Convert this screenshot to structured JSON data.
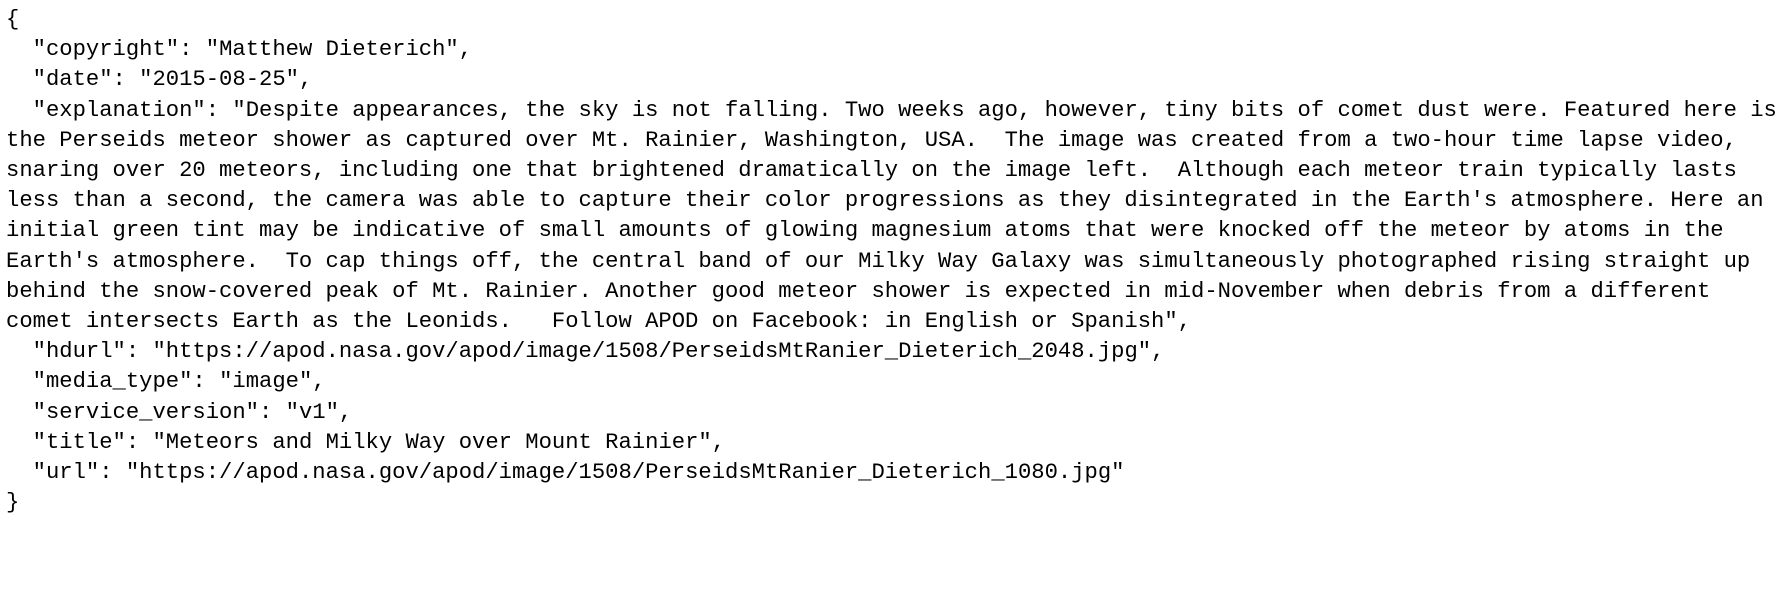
{
  "json_viewer": {
    "open_brace": "{",
    "close_brace": "}",
    "entries": [
      {
        "key": "\"copyright\"",
        "value": "\"Matthew Dieterich\"",
        "trail": ","
      },
      {
        "key": "\"date\"",
        "value": "\"2015-08-25\"",
        "trail": ","
      },
      {
        "key": "\"explanation\"",
        "value": "\"Despite appearances, the sky is not falling. Two weeks ago, however, tiny bits of comet dust were. Featured here is the Perseids meteor shower as captured over Mt. Rainier, Washington, USA.  The image was created from a two-hour time lapse video, snaring over 20 meteors, including one that brightened dramatically on the image left.  Although each meteor train typically lasts less than a second, the camera was able to capture their color progressions as they disintegrated in the Earth's atmosphere. Here an initial green tint may be indicative of small amounts of glowing magnesium atoms that were knocked off the meteor by atoms in the Earth's atmosphere.  To cap things off, the central band of our Milky Way Galaxy was simultaneously photographed rising straight up behind the snow-covered peak of Mt. Rainier. Another good meteor shower is expected in mid-November when debris from a different comet intersects Earth as the Leonids.   Follow APOD on Facebook: in English or Spanish\"",
        "trail": ","
      },
      {
        "key": "\"hdurl\"",
        "value": "\"https://apod.nasa.gov/apod/image/1508/PerseidsMtRanier_Dieterich_2048.jpg\"",
        "trail": ","
      },
      {
        "key": "\"media_type\"",
        "value": "\"image\"",
        "trail": ","
      },
      {
        "key": "\"service_version\"",
        "value": "\"v1\"",
        "trail": ","
      },
      {
        "key": "\"title\"",
        "value": "\"Meteors and Milky Way over Mount Rainier\"",
        "trail": ","
      },
      {
        "key": "\"url\"",
        "value": "\"https://apod.nasa.gov/apod/image/1508/PerseidsMtRanier_Dieterich_1080.jpg\"",
        "trail": ""
      }
    ]
  }
}
